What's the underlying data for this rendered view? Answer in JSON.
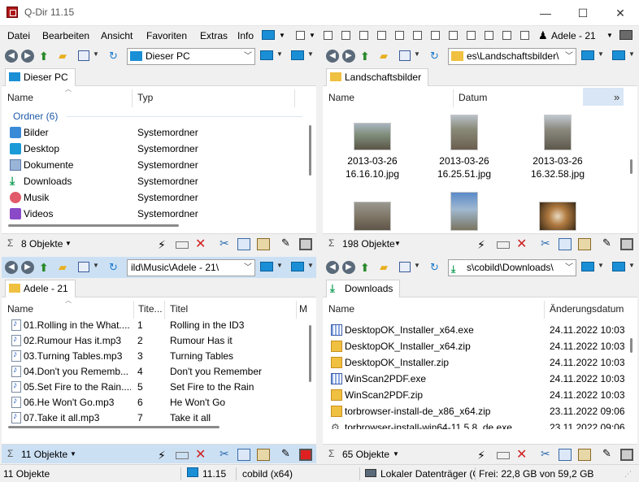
{
  "window": {
    "title": "Q-Dir 11.15",
    "min_label": "—",
    "max_label": "☐",
    "close_label": "✕"
  },
  "menu": {
    "items": [
      "Datei",
      "Bearbeiten",
      "Ansicht",
      "Favoriten",
      "Extras",
      "Info"
    ],
    "profile_label": "Adele - 21"
  },
  "pane_tl": {
    "address": "Dieser PC",
    "tab": "Dieser PC",
    "columns": [
      "Name",
      "Typ"
    ],
    "group": "Ordner (6)",
    "rows": [
      {
        "name": "Bilder",
        "type": "Systemordner",
        "icon": "pictures-icon"
      },
      {
        "name": "Desktop",
        "type": "Systemordner",
        "icon": "desktop-icon"
      },
      {
        "name": "Dokumente",
        "type": "Systemordner",
        "icon": "documents-icon"
      },
      {
        "name": "Downloads",
        "type": "Systemordner",
        "icon": "downloads-icon"
      },
      {
        "name": "Musik",
        "type": "Systemordner",
        "icon": "music-icon"
      },
      {
        "name": "Videos",
        "type": "Systemordner",
        "icon": "videos-icon"
      }
    ],
    "status": "8 Objekte"
  },
  "pane_tr": {
    "address": "es\\Landschaftsbilder\\",
    "tab": "Landschaftsbilder",
    "columns": [
      "Name",
      "Datum"
    ],
    "more": "»",
    "thumbs": [
      {
        "line1": "2013-03-26",
        "line2": "16.16.10.jpg"
      },
      {
        "line1": "2013-03-26",
        "line2": "16.25.51.jpg"
      },
      {
        "line1": "2013-03-26",
        "line2": "16.32.58.jpg"
      }
    ],
    "status": "198 Objekte"
  },
  "pane_bl": {
    "address": "ild\\Music\\Adele - 21\\",
    "tab": "Adele - 21",
    "columns": [
      "Name",
      "Tite...",
      "Titel",
      "M"
    ],
    "rows": [
      {
        "name": "01.Rolling in the What....",
        "num": "1",
        "title": "Rolling in the ID3"
      },
      {
        "name": "02.Rumour Has it.mp3",
        "num": "2",
        "title": "Rumour Has it"
      },
      {
        "name": "03.Turning Tables.mp3",
        "num": "3",
        "title": "Turning Tables"
      },
      {
        "name": "04.Don't you Rememb...",
        "num": "4",
        "title": "Don't you Remember"
      },
      {
        "name": "05.Set Fire to the Rain....",
        "num": "5",
        "title": "Set Fire to the Rain"
      },
      {
        "name": "06.He Won't Go.mp3",
        "num": "6",
        "title": "He Won't Go"
      },
      {
        "name": "07.Take it all.mp3",
        "num": "7",
        "title": "Take it all"
      }
    ],
    "status": "11 Objekte"
  },
  "pane_br": {
    "address": "s\\cobild\\Downloads\\",
    "tab": "Downloads",
    "columns": [
      "Name",
      "Änderungsdatum"
    ],
    "rows": [
      {
        "name": "DesktopOK_Installer_x64.exe",
        "date": "24.11.2022 10:03",
        "icon": "exe-icon"
      },
      {
        "name": "DesktopOK_Installer_x64.zip",
        "date": "24.11.2022 10:03",
        "icon": "zip-icon"
      },
      {
        "name": "DesktopOK_Installer.zip",
        "date": "24.11.2022 10:03",
        "icon": "zip-icon"
      },
      {
        "name": "WinScan2PDF.exe",
        "date": "24.11.2022 10:03",
        "icon": "exe-icon"
      },
      {
        "name": "WinScan2PDF.zip",
        "date": "24.11.2022 10:03",
        "icon": "zip-icon"
      },
      {
        "name": "torbrowser-install-de_x86_x64.zip",
        "date": "23.11.2022 09:06",
        "icon": "zip-icon"
      },
      {
        "name": "torbrowser-install-win64-11.5.8_de.exe",
        "date": "23.11.2022 09:06",
        "icon": "exe-icon"
      }
    ],
    "status": "65 Objekte"
  },
  "statusline": {
    "objects": "11 Objekte",
    "version": "11.15",
    "user": "cobild (x64)",
    "drive": "Lokaler Datenträger (C:)",
    "free": "Frei: 22,8 GB von 59,2 GB"
  }
}
